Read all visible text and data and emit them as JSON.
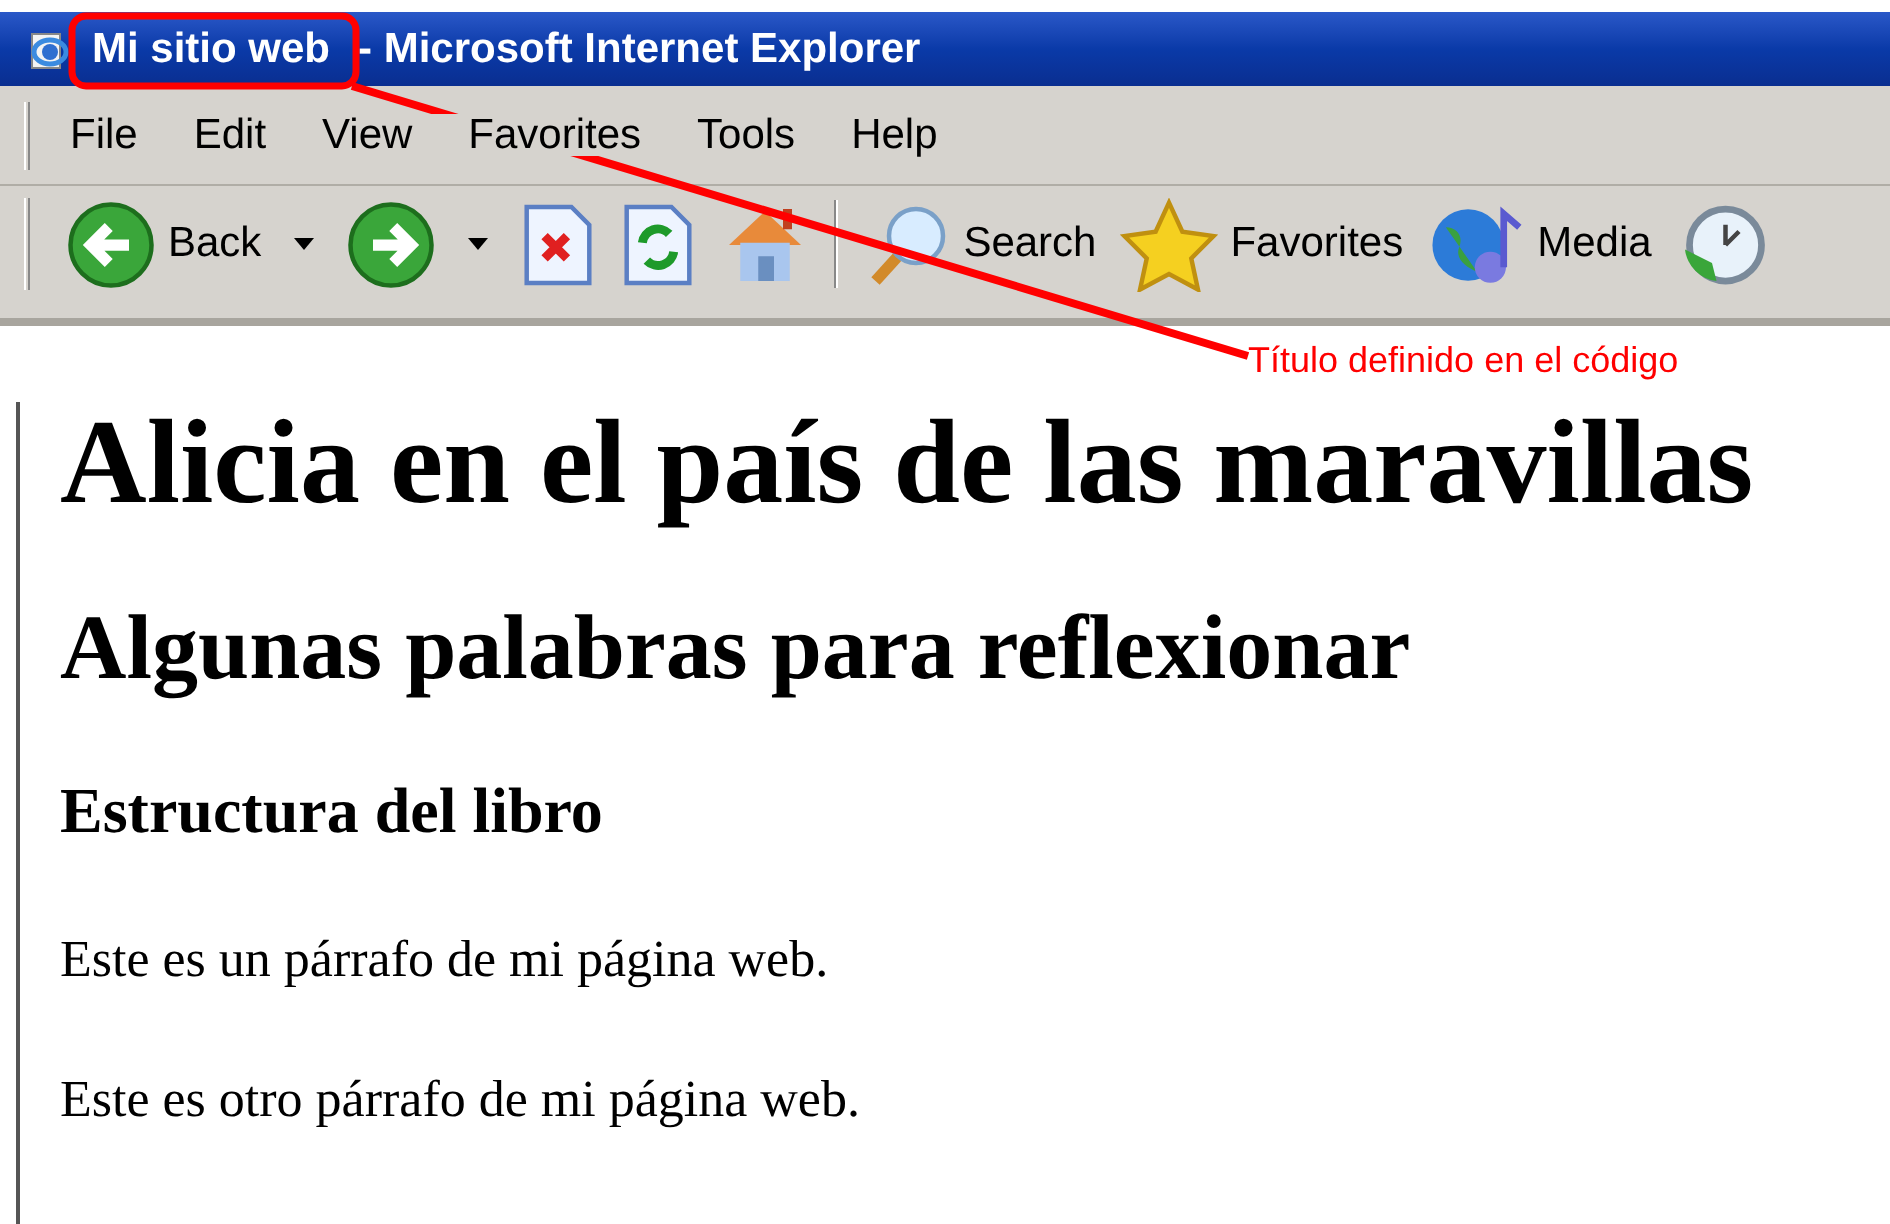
{
  "window": {
    "title_highlight": "Mi sitio web",
    "title_rest": "- Microsoft Internet Explorer"
  },
  "menu": [
    "File",
    "Edit",
    "View",
    "Favorites",
    "Tools",
    "Help"
  ],
  "toolbar": [
    {
      "kind": "back",
      "label": "Back",
      "dropdown": true
    },
    {
      "kind": "forward",
      "dropdown": true
    },
    {
      "kind": "stop"
    },
    {
      "kind": "refresh"
    },
    {
      "kind": "home"
    },
    {
      "kind": "separator"
    },
    {
      "kind": "search",
      "label": "Search"
    },
    {
      "kind": "favorites",
      "label": "Favorites"
    },
    {
      "kind": "media",
      "label": "Media"
    },
    {
      "kind": "history"
    }
  ],
  "annotation": {
    "text": "Título definido en el código"
  },
  "page": {
    "h1": "Alicia en el país de las maravillas",
    "h2": "Algunas palabras para reflexionar",
    "h3": "Estructura del libro",
    "paragraphs": [
      "Este es un párrafo de mi página web.",
      "Este es otro párrafo de mi página web."
    ]
  }
}
